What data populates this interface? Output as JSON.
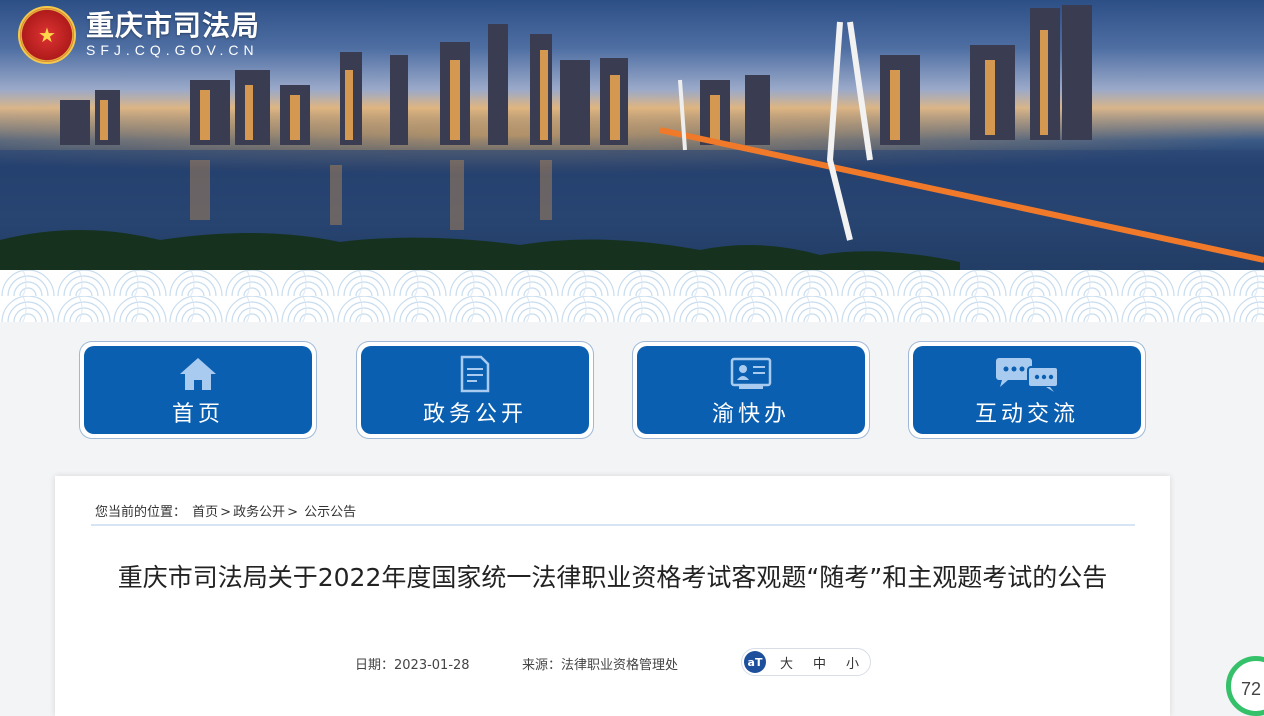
{
  "header": {
    "title_cn": "重庆市司法局",
    "title_en": "SFJ.CQ.GOV.CN"
  },
  "nav": [
    {
      "label": "首页",
      "icon": "home-icon"
    },
    {
      "label": "政务公开",
      "icon": "document-icon"
    },
    {
      "label": "渝快办",
      "icon": "id-card-icon"
    },
    {
      "label": "互动交流",
      "icon": "chat-icon"
    }
  ],
  "breadcrumb": {
    "prefix": "您当前的位置：",
    "home": "首页",
    "sep1": ">",
    "section": "政务公开",
    "sep2": ">",
    "current": "公示公告"
  },
  "article": {
    "title": "重庆市司法局关于2022年度国家统一法律职业资格考试客观题“随考”和主观题考试的公告",
    "date": "日期：2023-01-28",
    "source": "来源：法律职业资格管理处"
  },
  "font_size": {
    "icon_label": "aT",
    "large": "大",
    "medium": "中",
    "small": "小"
  },
  "float_badge": "72"
}
